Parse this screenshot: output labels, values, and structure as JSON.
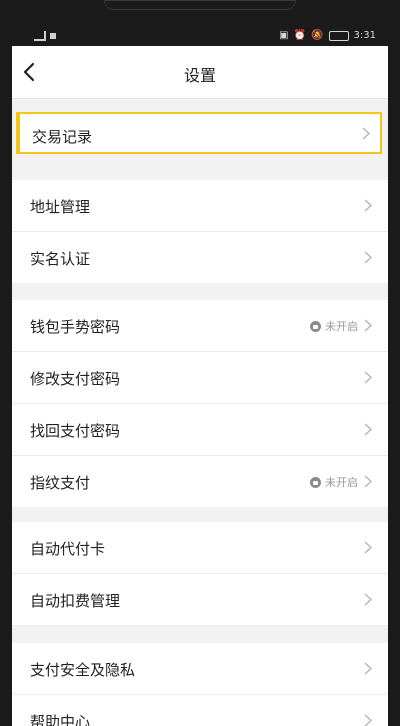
{
  "status_bar": {
    "left_text": "",
    "time": "3:31"
  },
  "nav": {
    "title": "设置"
  },
  "highlight": {
    "label": "交易记录"
  },
  "groups": [
    {
      "items": [
        {
          "label": "地址管理"
        },
        {
          "label": "实名认证"
        }
      ]
    },
    {
      "items": [
        {
          "label": "钱包手势密码",
          "status": "未开启"
        },
        {
          "label": "修改支付密码"
        },
        {
          "label": "找回支付密码"
        },
        {
          "label": "指纹支付",
          "status": "未开启"
        }
      ]
    },
    {
      "items": [
        {
          "label": "自动代付卡"
        },
        {
          "label": "自动扣费管理"
        }
      ]
    },
    {
      "items": [
        {
          "label": "支付安全及隐私"
        },
        {
          "label": "帮助中心"
        }
      ]
    }
  ],
  "colors": {
    "highlight": "#f5c518"
  }
}
